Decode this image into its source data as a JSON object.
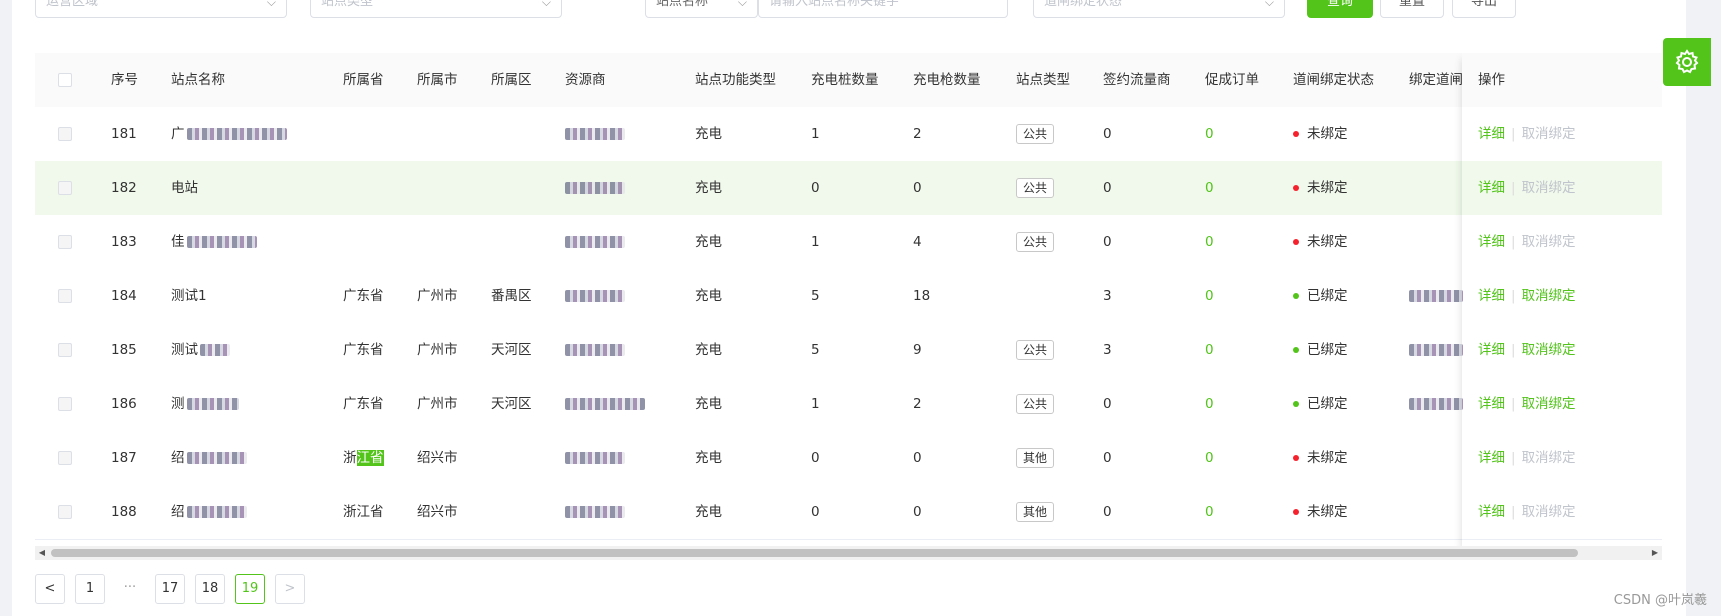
{
  "filters": {
    "region_placeholder": "运营区域",
    "station_type_placeholder": "站点类型",
    "name_select_value": "站点名称",
    "keyword_placeholder": "请输入站点名称关键字",
    "gate_status_placeholder": "道闸绑定状态",
    "query_label": "查询",
    "reset_label": "重置",
    "export_label": "导出"
  },
  "table": {
    "columns": [
      "序号",
      "站点名称",
      "所属省",
      "所属市",
      "所属区",
      "资源商",
      "站点功能类型",
      "充电桩数量",
      "充电枪数量",
      "站点类型",
      "签约流量商",
      "促成订单",
      "道闸绑定状态",
      "绑定道闸",
      "操作"
    ],
    "rows": [
      {
        "seq": "181",
        "name": "广",
        "province": "",
        "city": "",
        "district": "",
        "func": "充电",
        "piles": "1",
        "guns": "2",
        "type": "公共",
        "traffic": "0",
        "orders": "0",
        "status": "未绑定",
        "bound": false,
        "detail": "详细",
        "unbind": "取消绑定"
      },
      {
        "seq": "182",
        "name": "电站",
        "province": "",
        "city": "",
        "district": "",
        "func": "充电",
        "piles": "0",
        "guns": "0",
        "type": "公共",
        "traffic": "0",
        "orders": "0",
        "status": "未绑定",
        "bound": false,
        "detail": "详细",
        "unbind": "取消绑定"
      },
      {
        "seq": "183",
        "name": "佳",
        "province": "",
        "city": "",
        "district": "",
        "func": "充电",
        "piles": "1",
        "guns": "4",
        "type": "公共",
        "traffic": "0",
        "orders": "0",
        "status": "未绑定",
        "bound": false,
        "detail": "详细",
        "unbind": "取消绑定"
      },
      {
        "seq": "184",
        "name": "测试1",
        "province": "广东省",
        "city": "广州市",
        "district": "番禺区",
        "func": "充电",
        "piles": "5",
        "guns": "18",
        "type": "",
        "traffic": "3",
        "orders": "0",
        "status": "已绑定",
        "bound": true,
        "detail": "详细",
        "unbind": "取消绑定"
      },
      {
        "seq": "185",
        "name": "测试",
        "province": "广东省",
        "city": "广州市",
        "district": "天河区",
        "func": "充电",
        "piles": "5",
        "guns": "9",
        "type": "公共",
        "traffic": "3",
        "orders": "0",
        "status": "已绑定",
        "bound": true,
        "detail": "详细",
        "unbind": "取消绑定"
      },
      {
        "seq": "186",
        "name": "测",
        "province": "广东省",
        "city": "广州市",
        "district": "天河区",
        "func": "充电",
        "piles": "1",
        "guns": "2",
        "type": "公共",
        "traffic": "0",
        "orders": "0",
        "status": "已绑定",
        "bound": true,
        "detail": "详细",
        "unbind": "取消绑定"
      },
      {
        "seq": "187",
        "name": "绍",
        "province": "浙江省",
        "city": "绍兴市",
        "district": "",
        "func": "充电",
        "piles": "0",
        "guns": "0",
        "type": "其他",
        "traffic": "0",
        "orders": "0",
        "status": "未绑定",
        "bound": false,
        "detail": "详细",
        "unbind": "取消绑定"
      },
      {
        "seq": "188",
        "name": "绍",
        "province": "浙江省",
        "city": "绍兴市",
        "district": "",
        "func": "充电",
        "piles": "0",
        "guns": "0",
        "type": "其他",
        "traffic": "0",
        "orders": "0",
        "status": "未绑定",
        "bound": false,
        "detail": "详细",
        "unbind": "取消绑定"
      }
    ]
  },
  "pagination": {
    "prev": "<",
    "pages": [
      "1",
      "17",
      "18",
      "19"
    ],
    "ellipsis": "···",
    "current": "19",
    "next": ">"
  },
  "watermark": "CSDN @叶岚羲",
  "colors": {
    "accent": "#52c41a",
    "unbound_dot": "#f5222d",
    "bound_dot": "#52c41a",
    "highlight_row": "#f0f9eb"
  },
  "icons": {
    "settings": "gear-icon"
  }
}
